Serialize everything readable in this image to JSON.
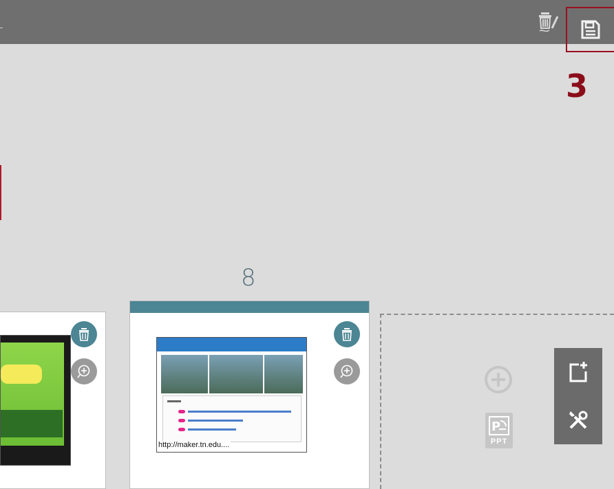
{
  "toolbar": {
    "clear_icon": "trash-pen-icon",
    "save_icon": "floppy-disk-icon"
  },
  "annotation": {
    "step": "3"
  },
  "slides": {
    "current_page_number": "8",
    "current_url_caption": "http://maker.tn.edu...."
  },
  "add_slot": {
    "add_icon": "plus-circle-icon",
    "ppt_icon": "ppt-import-icon",
    "ppt_label": "PPT"
  },
  "side_tools": {
    "new_slide_icon": "new-slide-icon",
    "settings_icon": "tools-icon"
  },
  "colors": {
    "toolbar": "#6f6f6f",
    "accent": "#4c8593",
    "annotation": "#8b0d1a"
  }
}
